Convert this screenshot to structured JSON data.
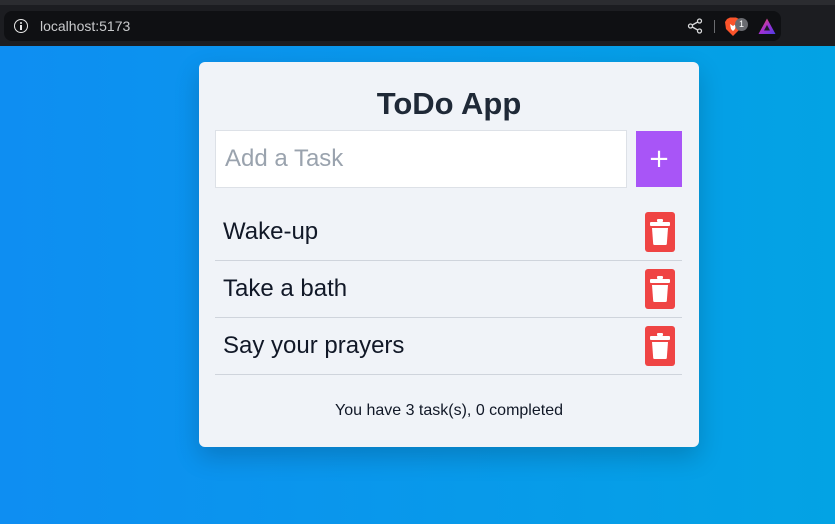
{
  "browser": {
    "url": "localhost:5173",
    "brave_badge_count": "1"
  },
  "app": {
    "title": "ToDo App",
    "input_placeholder": "Add a Task",
    "input_value": "",
    "add_button_label": "+",
    "tasks": [
      {
        "text": "Wake-up"
      },
      {
        "text": "Take a bath"
      },
      {
        "text": "Say your prayers"
      }
    ],
    "status": "You have 3 task(s), 0 completed"
  },
  "colors": {
    "background_gradient_start": "#0e8ef2",
    "background_gradient_end": "#03a3e4",
    "card": "#f0f3f8",
    "add_button": "#a855f7",
    "delete_button": "#ef4444"
  },
  "icons": {
    "site_info": "info-icon",
    "share": "share-icon",
    "brave_shields": "brave-lion-icon",
    "brave_rewards": "rewards-triangle-icon",
    "delete": "trash-icon"
  }
}
